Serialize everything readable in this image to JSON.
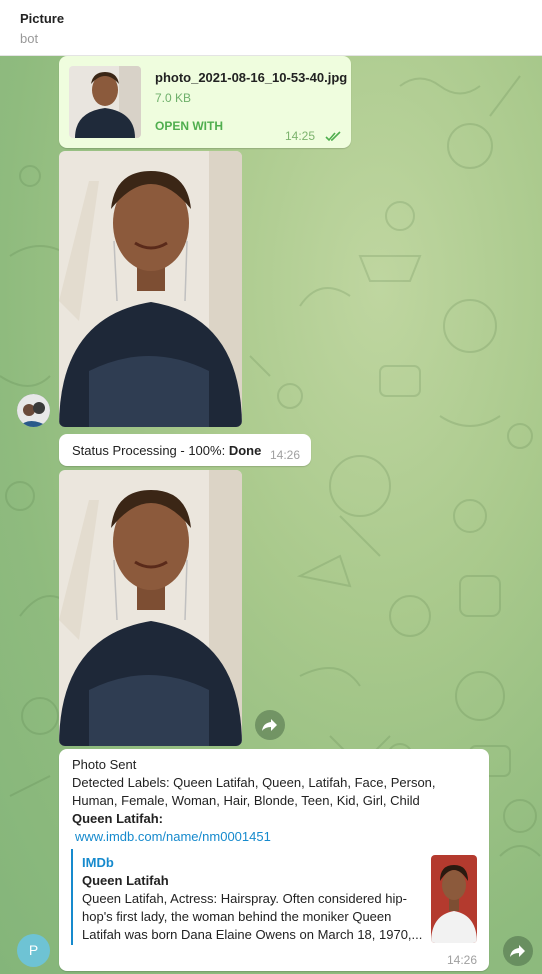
{
  "header": {
    "title": "Picture",
    "subtitle": "bot"
  },
  "file_message": {
    "filename": "photo_2021-08-16_10-53-40.jpg",
    "size": "7.0 KB",
    "action": "OPEN WITH",
    "time": "14:25",
    "status_icon": "double-check-icon"
  },
  "status_message": {
    "text": "Status Processing - 100%: ",
    "bold": "Done",
    "time": "14:26"
  },
  "result_message": {
    "line1": "Photo Sent",
    "line2": "Detected Labels: Queen Latifah, Queen, Latifah, Face, Person,",
    "line3": "Human, Female, Woman, Hair, Blonde, Teen, Kid, Girl, Child",
    "name_label": "Queen Latifah:",
    "url": "www.imdb.com/name/nm0001451",
    "preview": {
      "site": "IMDb",
      "title": "Queen Latifah",
      "desc1": "Queen Latifah, Actress: Hairspray. Often considered hip-",
      "desc2": "hop's first lady, the woman behind the moniker Queen",
      "desc3": "Latifah was born Dana Elaine Owens on March 18, 1970,..."
    },
    "time": "14:26"
  },
  "avatars": {
    "bot_initial": "P"
  },
  "colors": {
    "accent": "#4fae4e",
    "link": "#168acd",
    "chat_bg": "#a9c98c"
  }
}
